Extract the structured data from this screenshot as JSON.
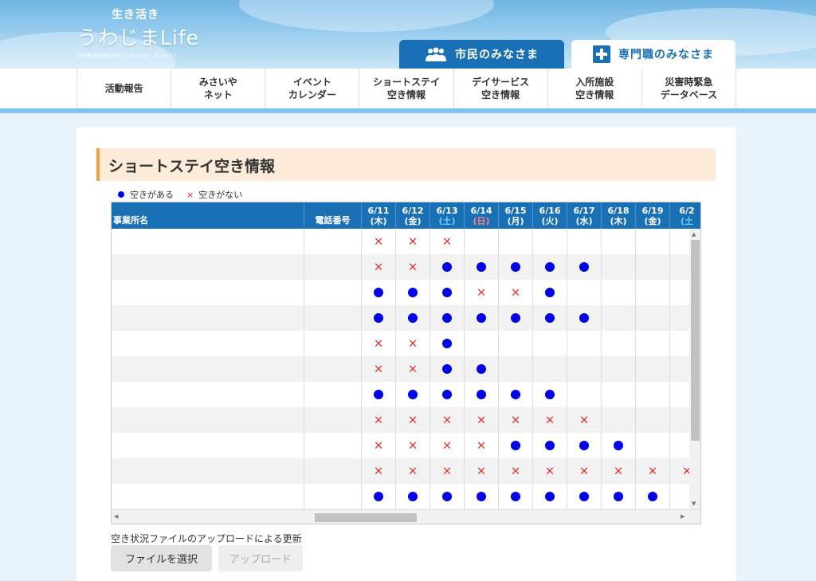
{
  "site": {
    "logo_small": "生き活き",
    "logo_main": "うわじまLife",
    "logo_sub": "宇和島市地域包括ケアシステムポータルサイト"
  },
  "tabs": [
    {
      "label": "市民のみなさま",
      "icon": "people-icon",
      "active": false
    },
    {
      "label": "専門職のみなさま",
      "icon": "medical-cross-icon",
      "active": true
    }
  ],
  "nav": [
    "活動報告",
    "みさいや\nネット",
    "イベント\nカレンダー",
    "ショートステイ\n空き情報",
    "デイサービス\n空き情報",
    "入所施設\n空き情報",
    "災害時緊急\nデータベース"
  ],
  "page_title": "ショートステイ空き情報",
  "legend": {
    "available": "空きがある",
    "unavailable": "空きがない",
    "available_color": "#0000ee",
    "unavailable_color": "#ee2222"
  },
  "table": {
    "col_name": "事業所名",
    "col_phone": "電話番号",
    "dates": [
      {
        "date": "6/11",
        "dow": "(木)",
        "type": "weekday"
      },
      {
        "date": "6/12",
        "dow": "(金)",
        "type": "weekday"
      },
      {
        "date": "6/13",
        "dow": "(土)",
        "type": "sat"
      },
      {
        "date": "6/14",
        "dow": "(日)",
        "type": "sun"
      },
      {
        "date": "6/15",
        "dow": "(月)",
        "type": "weekday"
      },
      {
        "date": "6/16",
        "dow": "(火)",
        "type": "weekday"
      },
      {
        "date": "6/17",
        "dow": "(水)",
        "type": "weekday"
      },
      {
        "date": "6/18",
        "dow": "(木)",
        "type": "weekday"
      },
      {
        "date": "6/19",
        "dow": "(金)",
        "type": "weekday"
      },
      {
        "date": "6/2",
        "dow": "(土",
        "type": "sat"
      }
    ],
    "rows": [
      [
        "x",
        "x",
        "x",
        "",
        "",
        "",
        "",
        "",
        "",
        ""
      ],
      [
        "x",
        "x",
        "o",
        "o",
        "o",
        "o",
        "o",
        "",
        "",
        ""
      ],
      [
        "o",
        "o",
        "o",
        "x",
        "x",
        "o",
        "",
        "",
        "",
        ""
      ],
      [
        "o",
        "o",
        "o",
        "o",
        "o",
        "o",
        "o",
        "",
        "",
        ""
      ],
      [
        "x",
        "x",
        "o",
        "",
        "",
        "",
        "",
        "",
        "",
        ""
      ],
      [
        "x",
        "x",
        "o",
        "o",
        "",
        "",
        "",
        "",
        "",
        ""
      ],
      [
        "o",
        "o",
        "o",
        "o",
        "o",
        "o",
        "",
        "",
        "",
        ""
      ],
      [
        "x",
        "x",
        "x",
        "x",
        "x",
        "x",
        "x",
        "",
        "",
        ""
      ],
      [
        "x",
        "x",
        "x",
        "x",
        "o",
        "o",
        "o",
        "o",
        "",
        ""
      ],
      [
        "x",
        "x",
        "x",
        "x",
        "x",
        "x",
        "x",
        "x",
        "x",
        "x"
      ],
      [
        "o",
        "o",
        "o",
        "o",
        "o",
        "o",
        "o",
        "o",
        "o",
        ""
      ]
    ]
  },
  "upload": {
    "label": "空き状況ファイルのアップロードによる更新",
    "choose_button": "ファイルを選択",
    "upload_button": "アップロード"
  }
}
